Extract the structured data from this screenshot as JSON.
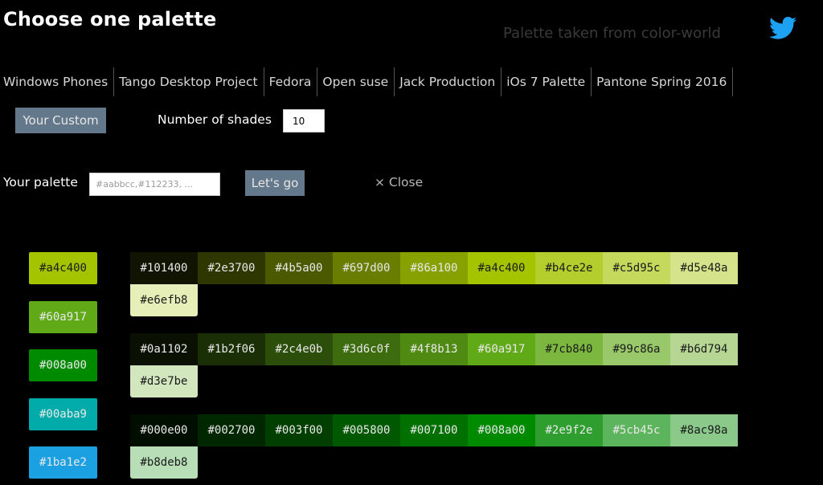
{
  "header": {
    "title": "Choose one palette",
    "credit": "Palette taken from color-world",
    "twitter_icon": "twitter-bird-icon",
    "twitter_color": "#1da1f2"
  },
  "palettes_nav": [
    "Windows Phones",
    "Tango Desktop Project",
    "Fedora",
    "Open suse",
    "Jack Production",
    "iOs 7 Palette",
    "Pantone Spring 2016"
  ],
  "custom": {
    "button_label": "Your Custom",
    "shades_label": "Number of shades",
    "shades_value": "10",
    "palette_label": "Your palette",
    "palette_placeholder": "#aabbcc,#112233, ...",
    "go_label": "Let's go",
    "close_label": "× Close"
  },
  "colors": {
    "background": "#000000",
    "button": "#64788c"
  },
  "base_colors": [
    "#a4c400",
    "#60a917",
    "#008a00",
    "#00aba9",
    "#1ba1e2"
  ],
  "shade_rows": [
    [
      "#101400",
      "#2e3700",
      "#4b5a00",
      "#697d00",
      "#86a100",
      "#a4c400",
      "#b4ce2e",
      "#c5d95c",
      "#d5e48a",
      "#e6efb8"
    ],
    [
      "#0a1102",
      "#1b2f06",
      "#2c4e0b",
      "#3d6c0f",
      "#4f8b13",
      "#60a917",
      "#7cb840",
      "#99c86a",
      "#b6d794",
      "#d3e7be"
    ],
    [
      "#000e00",
      "#002700",
      "#003f00",
      "#005800",
      "#007100",
      "#008a00",
      "#2e9f2e",
      "#5cb45c",
      "#8ac98a",
      "#b8deb8"
    ]
  ]
}
